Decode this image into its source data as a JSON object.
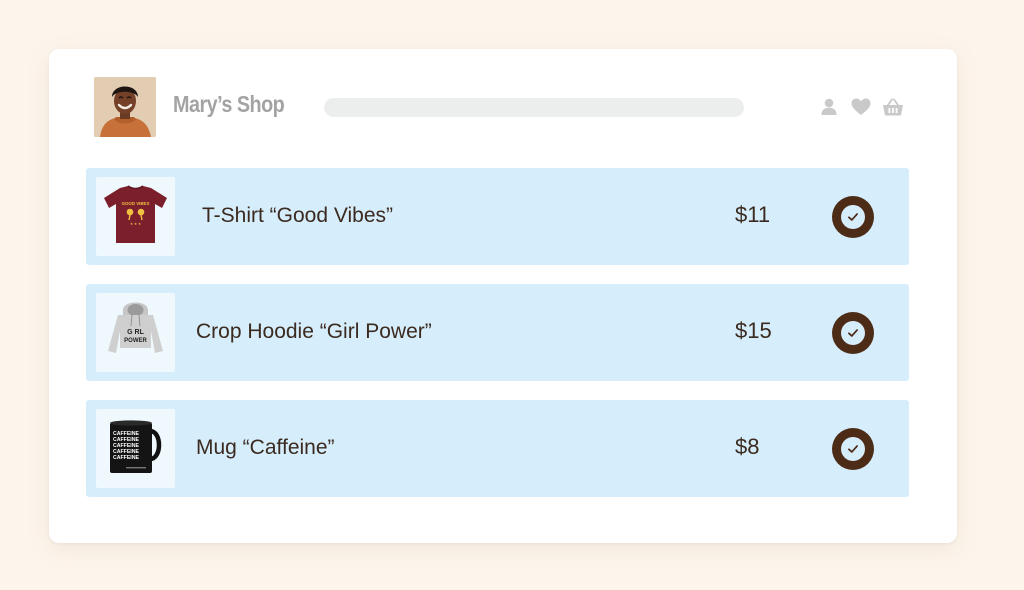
{
  "shop": {
    "title": "Mary’s Shop",
    "avatar_icon": "avatar-photo",
    "search_placeholder": ""
  },
  "header_icons": [
    "user-icon",
    "heart-icon",
    "basket-icon"
  ],
  "products": [
    {
      "name": "T-Shirt “Good Vibes”",
      "price": "$11",
      "image": "tshirt-image",
      "checked": true
    },
    {
      "name": "Crop Hoodie “Girl Power”",
      "price": "$15",
      "image": "hoodie-image",
      "checked": true
    },
    {
      "name": "Mug “Caffeine”",
      "price": "$8",
      "image": "mug-image",
      "checked": true
    }
  ],
  "colors": {
    "page_bg": "#fdf5ec",
    "row_bg": "#d6edfb",
    "check_brown": "#4d2c17",
    "text_dark": "#3b2a1f",
    "title_gray": "#a3a3a3"
  }
}
